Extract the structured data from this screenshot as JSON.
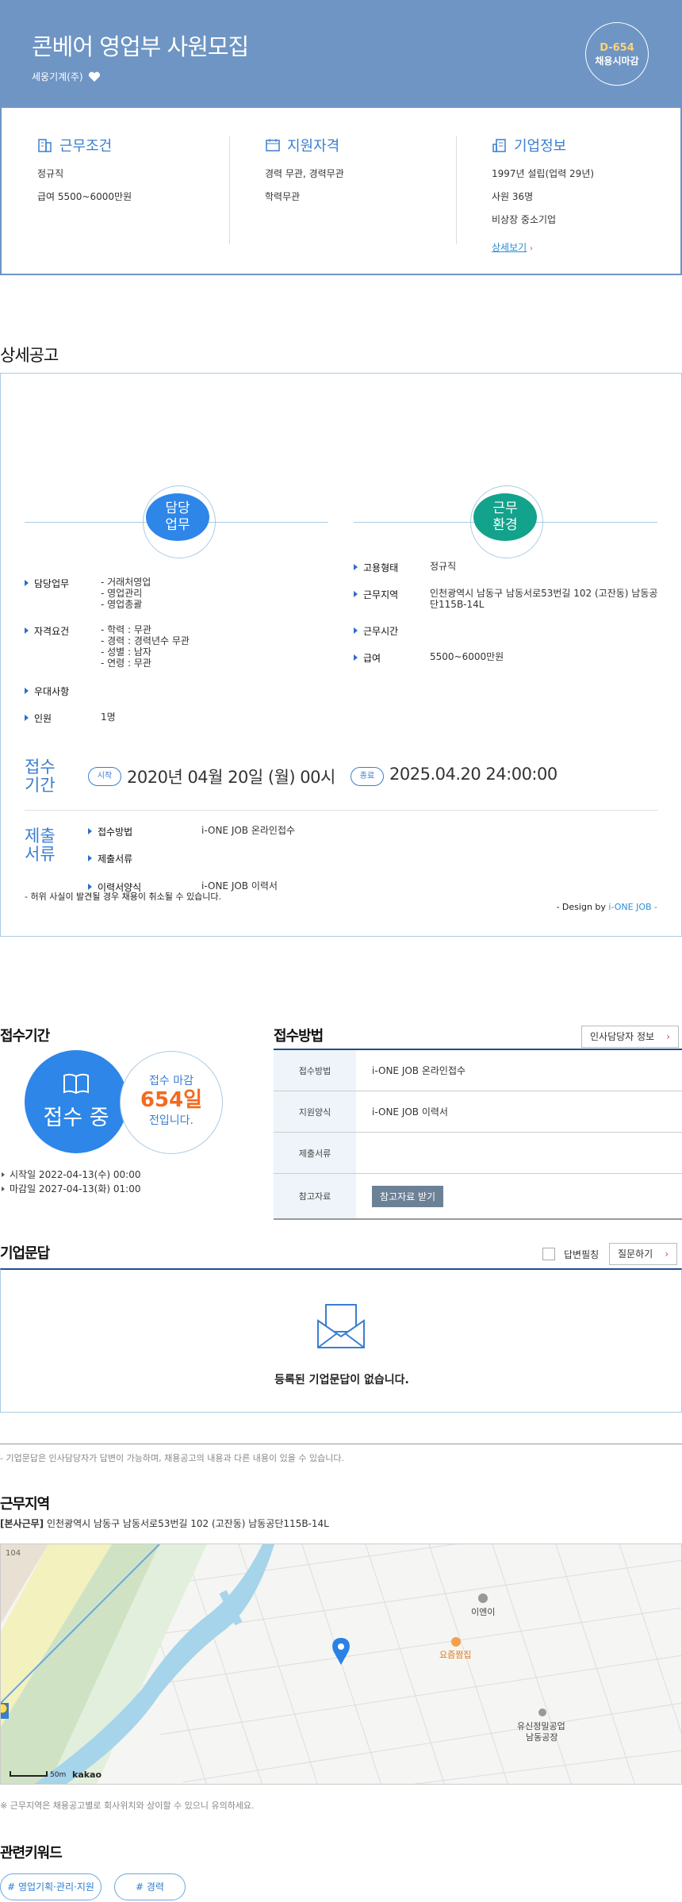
{
  "header": {
    "title": "콘베어 영업부 사원모집",
    "company": "세웅기계(주)",
    "dday": "D-654",
    "deadline": "채용시마감"
  },
  "summary": {
    "work": {
      "title": "근무조건",
      "lines": [
        "정규직",
        "급여 5500~6000만원"
      ]
    },
    "qual": {
      "title": "지원자격",
      "lines": [
        "경력 무관, 경력무관",
        "학력무관"
      ]
    },
    "corp": {
      "title": "기업정보",
      "lines": [
        "1997년 설립(업력 29년)",
        "사원 36명",
        "비상장 중소기업"
      ],
      "more": "상세보기"
    }
  },
  "detail": {
    "section_title": "상세공고",
    "duty_circle": "담당\n업무",
    "env_circle": "근무\n환경",
    "left": [
      {
        "label": "담당업무",
        "value": "- 거래처영업\n- 영업관리\n- 영업총괄"
      },
      {
        "label": "자격요건",
        "value": "- 학력 : 무관\n- 경력 : 경력년수 무관\n- 성별 : 남자\n- 연령 : 무관"
      },
      {
        "label": "우대사항",
        "value": ""
      },
      {
        "label": "인원",
        "value": "1명"
      }
    ],
    "right": [
      {
        "label": "고용형태",
        "value": "정규직"
      },
      {
        "label": "근무지역",
        "value": "인천광역시 남동구 남동서로53번길 102 (고잔동) 남동공단115B-14L"
      },
      {
        "label": "근무시간",
        "value": ""
      },
      {
        "label": "급여",
        "value": "5500~6000만원"
      }
    ],
    "period_label": "접수\n기간",
    "start_pill": "시작",
    "start_date": "2020년 04월 20일 (월) 00시",
    "end_pill": "종료",
    "end_date": "2025.04.20 24:00:00",
    "docs_label": "제출\n서류",
    "docs": [
      {
        "label": "접수방법",
        "value": "i-ONE JOB 온라인접수"
      },
      {
        "label": "제출서류",
        "value": ""
      },
      {
        "label": "이력서양식",
        "value": "i-ONE JOB 이력서"
      }
    ],
    "disclaimer": "- 허위 사실이 발견될 경우 채용이 취소될 수 있습니다.",
    "design_by": "- Design by ",
    "design_brand": "i-ONE JOB -"
  },
  "receipt": {
    "title": "접수기간",
    "status": "접수 중",
    "ring_top": "접수 마감",
    "ring_days": "654일",
    "ring_bottom": "전입니다.",
    "start": "시작일 2022-04-13(수) 00:00",
    "end": "마감일 2027-04-13(화) 01:00"
  },
  "method": {
    "title": "접수방법",
    "hr_button": "인사담당자 정보",
    "rows": [
      {
        "th": "접수방법",
        "td": "i-ONE JOB 온라인접수"
      },
      {
        "th": "지원양식",
        "td": "i-ONE JOB 이력서"
      },
      {
        "th": "제출서류",
        "td": ""
      },
      {
        "th": "참고자료",
        "td": ""
      }
    ],
    "ref_button": "참고자료 받기"
  },
  "qa": {
    "title": "기업문답",
    "answered_label": "답변필칭",
    "ask_button": "질문하기",
    "empty": "등록된 기업문답이 없습니다.",
    "note": "- 기업문답은 인사담당자가 답변이 가능하며, 채용공고의 내용과 다른 내용이 있을 수 있습니다."
  },
  "location": {
    "title": "근무지역",
    "tag": "[본사근무]",
    "address": "인천광역시 남동구 남동서로53번길 102 (고잔동) 남동공단115B-14L",
    "map_labels": {
      "road": "104",
      "poi1": "이엔이",
      "poi2": "요즘짬집",
      "poi3a": "유신정밀공업",
      "poi3b": "남동공장",
      "scale": "50m",
      "brand": "kakao"
    },
    "note": "※ 근무지역은 채용공고별로 회사위치와 상이할 수 있으니 유의하세요."
  },
  "keywords": {
    "title": "관련키워드",
    "items": [
      "# 영업기획·관리·지원",
      "# 경력"
    ]
  },
  "colors": {
    "header": "#6e95c4",
    "accent": "#2d86e8",
    "teal": "#13a28c",
    "orange": "#f36a1f"
  }
}
